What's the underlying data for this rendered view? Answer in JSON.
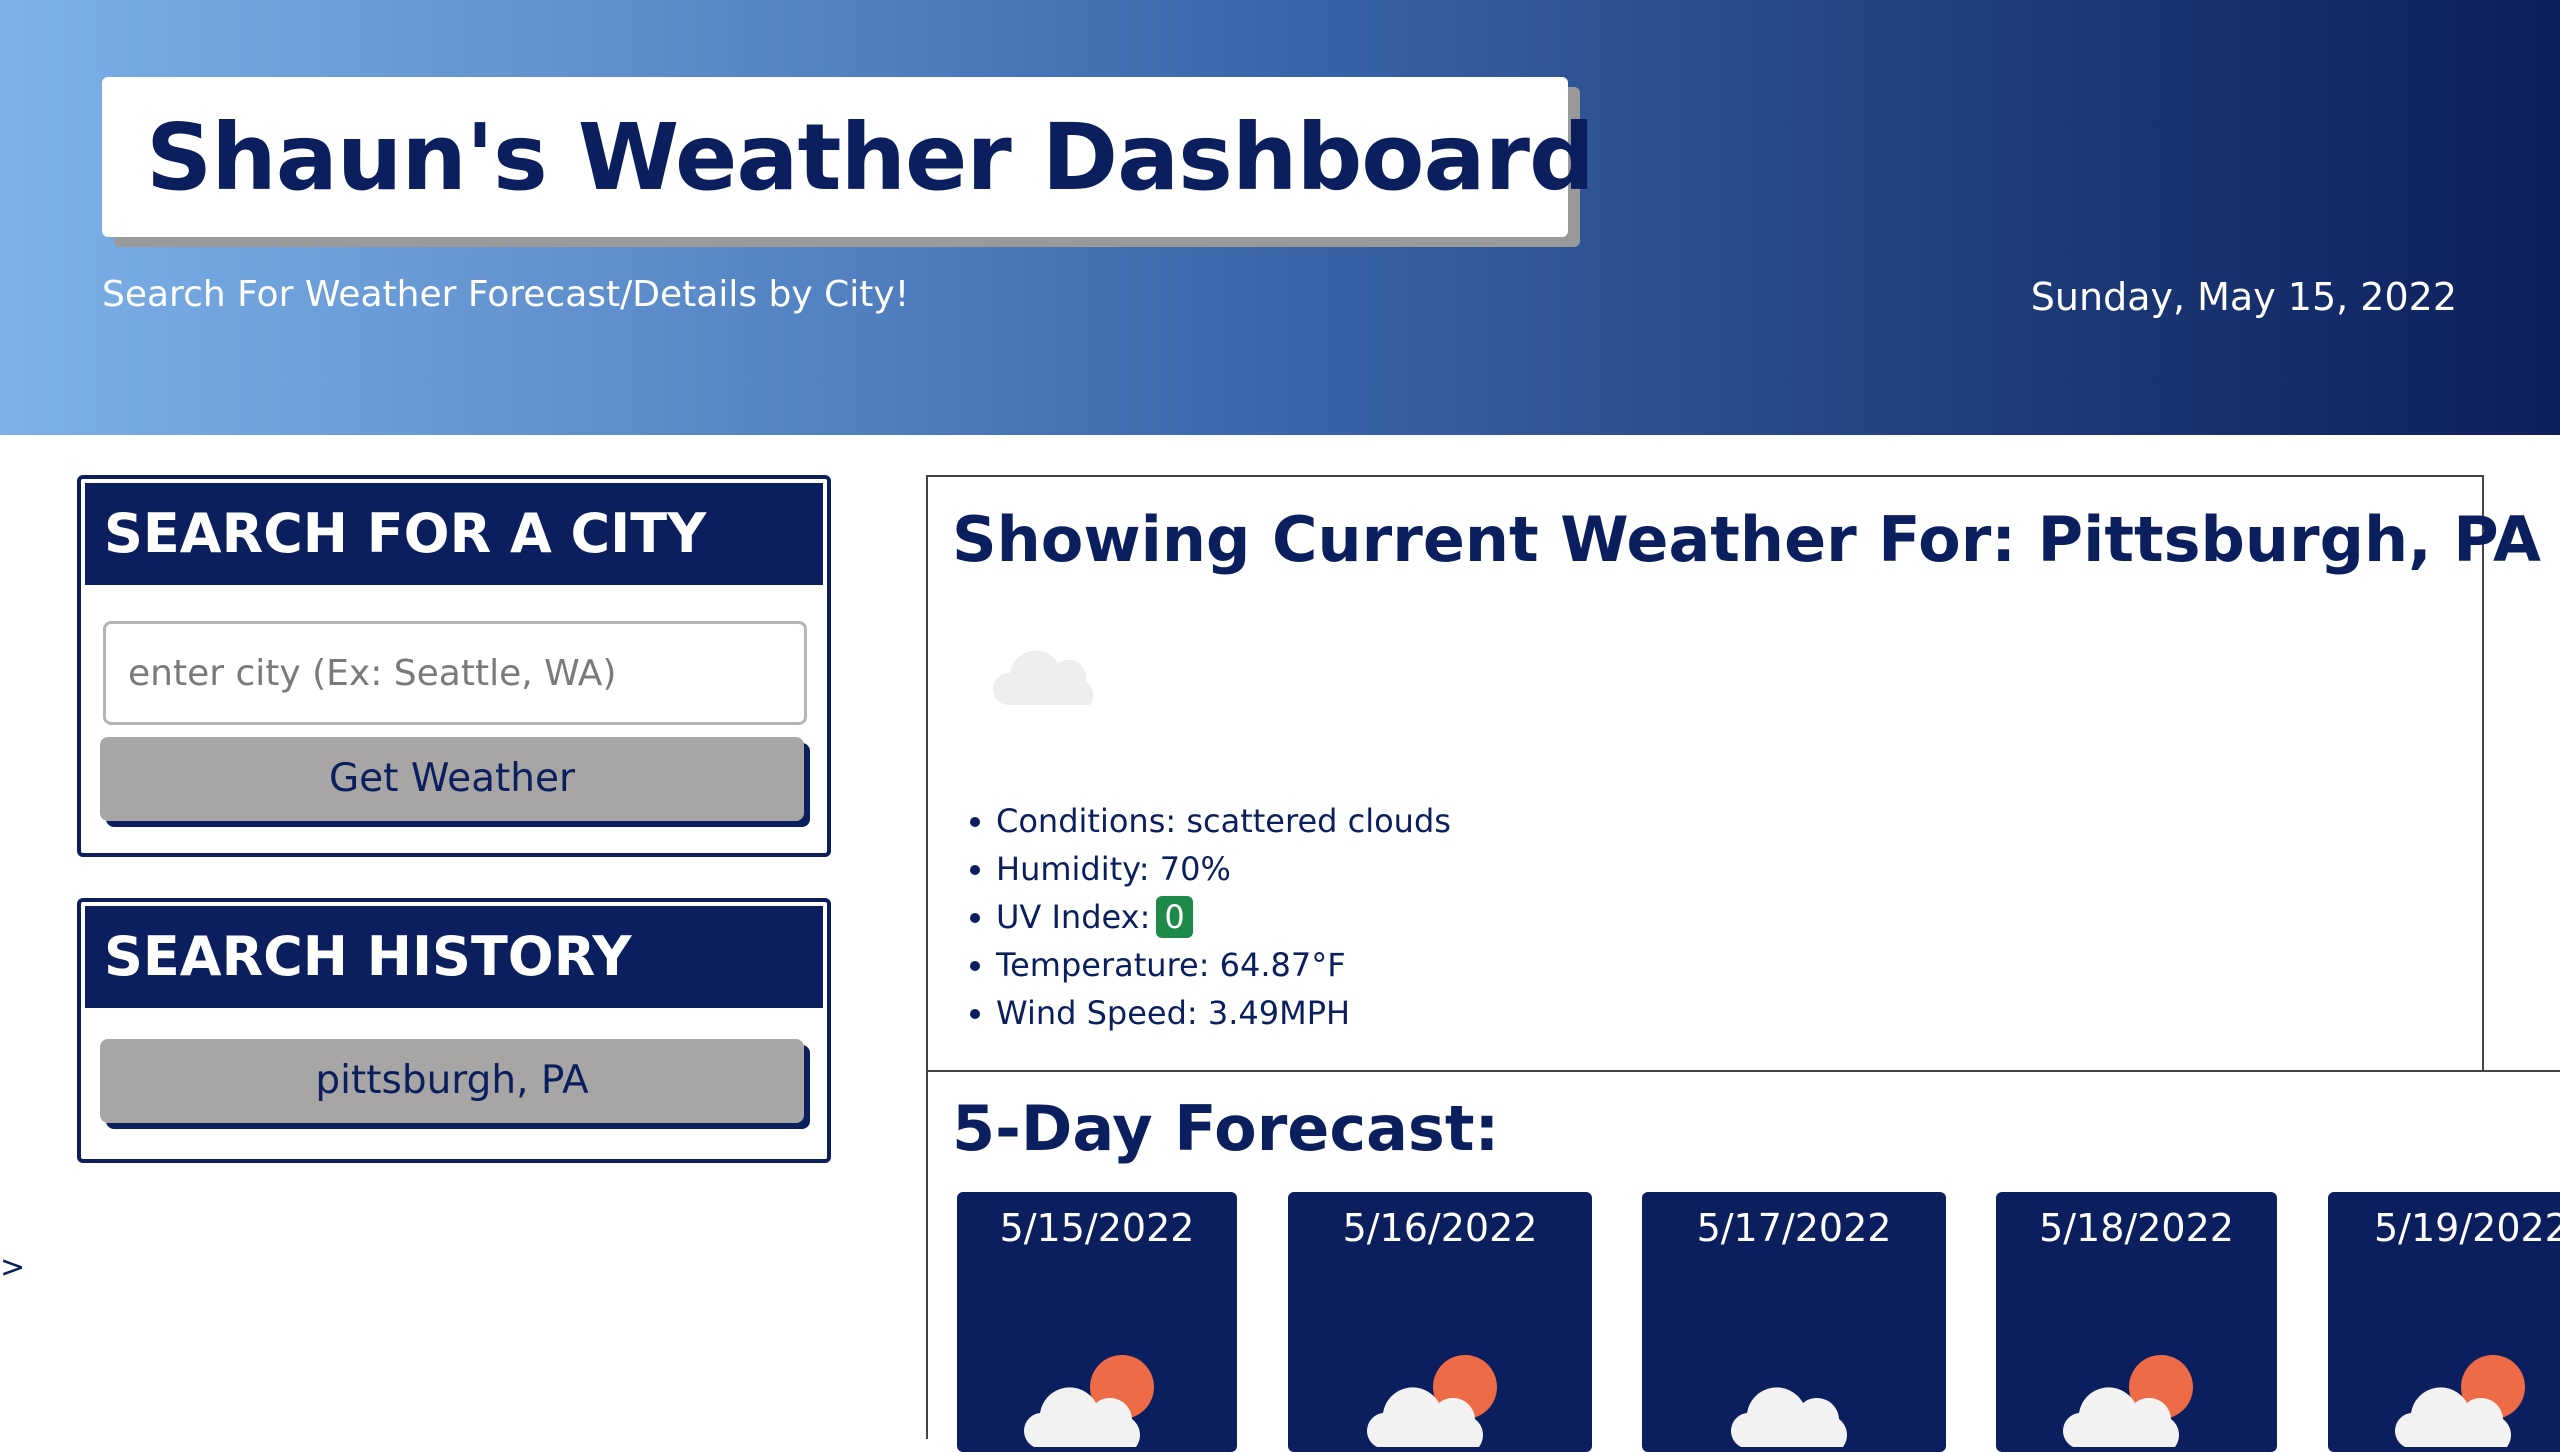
{
  "header": {
    "title": "Shaun's Weather Dashboard",
    "title_icon": "sun-cloud-rain-icon",
    "subtitle": "Search For Weather Forecast/Details by City!",
    "date": "Sunday, May 15, 2022"
  },
  "search": {
    "heading": "SEARCH FOR A CITY",
    "placeholder": "enter city (Ex: Seattle, WA)",
    "value": "",
    "button_label": "Get Weather"
  },
  "history": {
    "heading": "SEARCH HISTORY",
    "items": [
      "pittsburgh, PA"
    ]
  },
  "stray_text": ">",
  "current": {
    "title": "Showing Current Weather For: Pittsburgh, PA",
    "icon": "scattered-clouds-icon",
    "conditions_label": "Conditions: scattered clouds",
    "humidity_label": "Humidity: 70%",
    "uv_label": "UV Index:",
    "uv_value": "0",
    "uv_color": "#1e8a4a",
    "temperature_label": "Temperature: 64.87°F",
    "wind_label": "Wind Speed: 3.49MPH"
  },
  "forecast": {
    "title": "5-Day Forecast:",
    "days": [
      {
        "date": "5/15/2022",
        "icon": "cloud-sun-icon"
      },
      {
        "date": "5/16/2022",
        "icon": "cloud-sun-icon"
      },
      {
        "date": "5/17/2022",
        "icon": "cloud-icon"
      },
      {
        "date": "5/18/2022",
        "icon": "cloud-sun-icon"
      },
      {
        "date": "5/19/2022",
        "icon": "cloud-sun-icon"
      }
    ]
  },
  "colors": {
    "navy": "#0b1f5e",
    "button_gray": "#a8a6a4",
    "sun": "#ee6b47",
    "header_gradient_start": "#7db1e8",
    "header_gradient_end": "#0c1f5c"
  }
}
